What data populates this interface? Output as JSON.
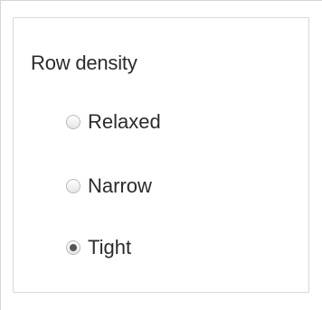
{
  "panel": {
    "title": "Row density",
    "options": [
      {
        "label": "Relaxed",
        "checked": false
      },
      {
        "label": "Narrow",
        "checked": false
      },
      {
        "label": "Tight",
        "checked": true
      }
    ]
  }
}
